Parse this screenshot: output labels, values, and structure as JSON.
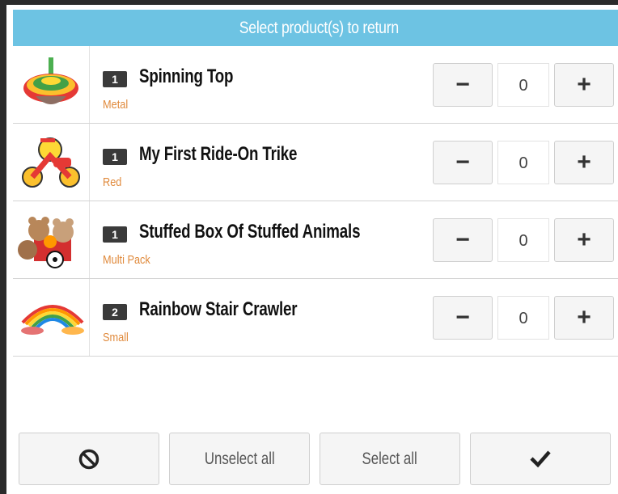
{
  "header": {
    "title": "Select product(s) to return"
  },
  "products": [
    {
      "qty": "1",
      "name": "Spinning Top",
      "variant": "Metal",
      "count": "0",
      "image": "spinning-top-image"
    },
    {
      "qty": "1",
      "name": "My First Ride-On Trike",
      "variant": "Red",
      "count": "0",
      "image": "trike-image"
    },
    {
      "qty": "1",
      "name": "Stuffed Box Of Stuffed Animals",
      "variant": "Multi Pack",
      "count": "0",
      "image": "stuffed-animals-image"
    },
    {
      "qty": "2",
      "name": "Rainbow Stair Crawler",
      "variant": "Small",
      "count": "0",
      "image": "rainbow-spring-image"
    }
  ],
  "stepper": {
    "minus_symbol": "−",
    "plus_symbol": "+"
  },
  "footer": {
    "cancel_icon": "ban-icon",
    "unselect_all_label": "Unselect all",
    "select_all_label": "Select all",
    "confirm_icon": "checkmark-icon"
  },
  "colors": {
    "header_bg": "#6dc3e3",
    "variant_text": "#e08a3c",
    "badge_bg": "#3a3a3a"
  }
}
